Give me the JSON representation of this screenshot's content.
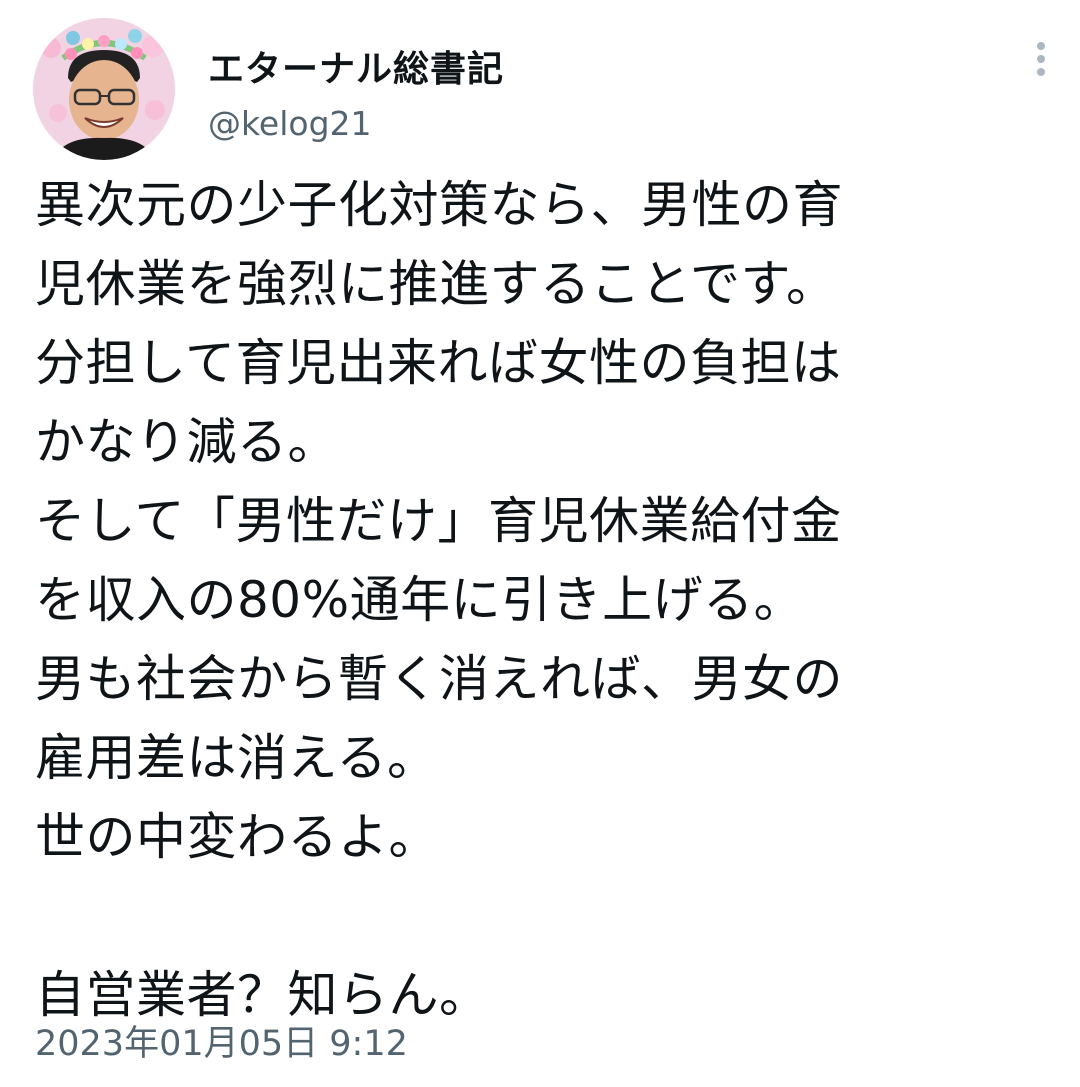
{
  "user": {
    "display_name": "エターナル総書記",
    "handle": "@kelog21"
  },
  "tweet": {
    "lines": [
      "異次元の少子化対策なら、男性の育",
      "児休業を強烈に推進することです。",
      "分担して育児出来れば女性の負担は",
      "かなり減る。",
      "そして「男性だけ」育児休業給付金",
      "を収入の80%通年に引き上げる。",
      "男も社会から暫く消えれば、男女の",
      "雇用差は消える。",
      "世の中変わるよ。",
      "",
      "自営業者？知らん。"
    ],
    "timestamp": "2023年01月05日 9:12"
  },
  "icons": {
    "more": "more-vertical-icon",
    "avatar": "profile-avatar"
  },
  "colors": {
    "text": "#0f1419",
    "secondary": "#536471",
    "more_dots": "#aab8c2"
  }
}
